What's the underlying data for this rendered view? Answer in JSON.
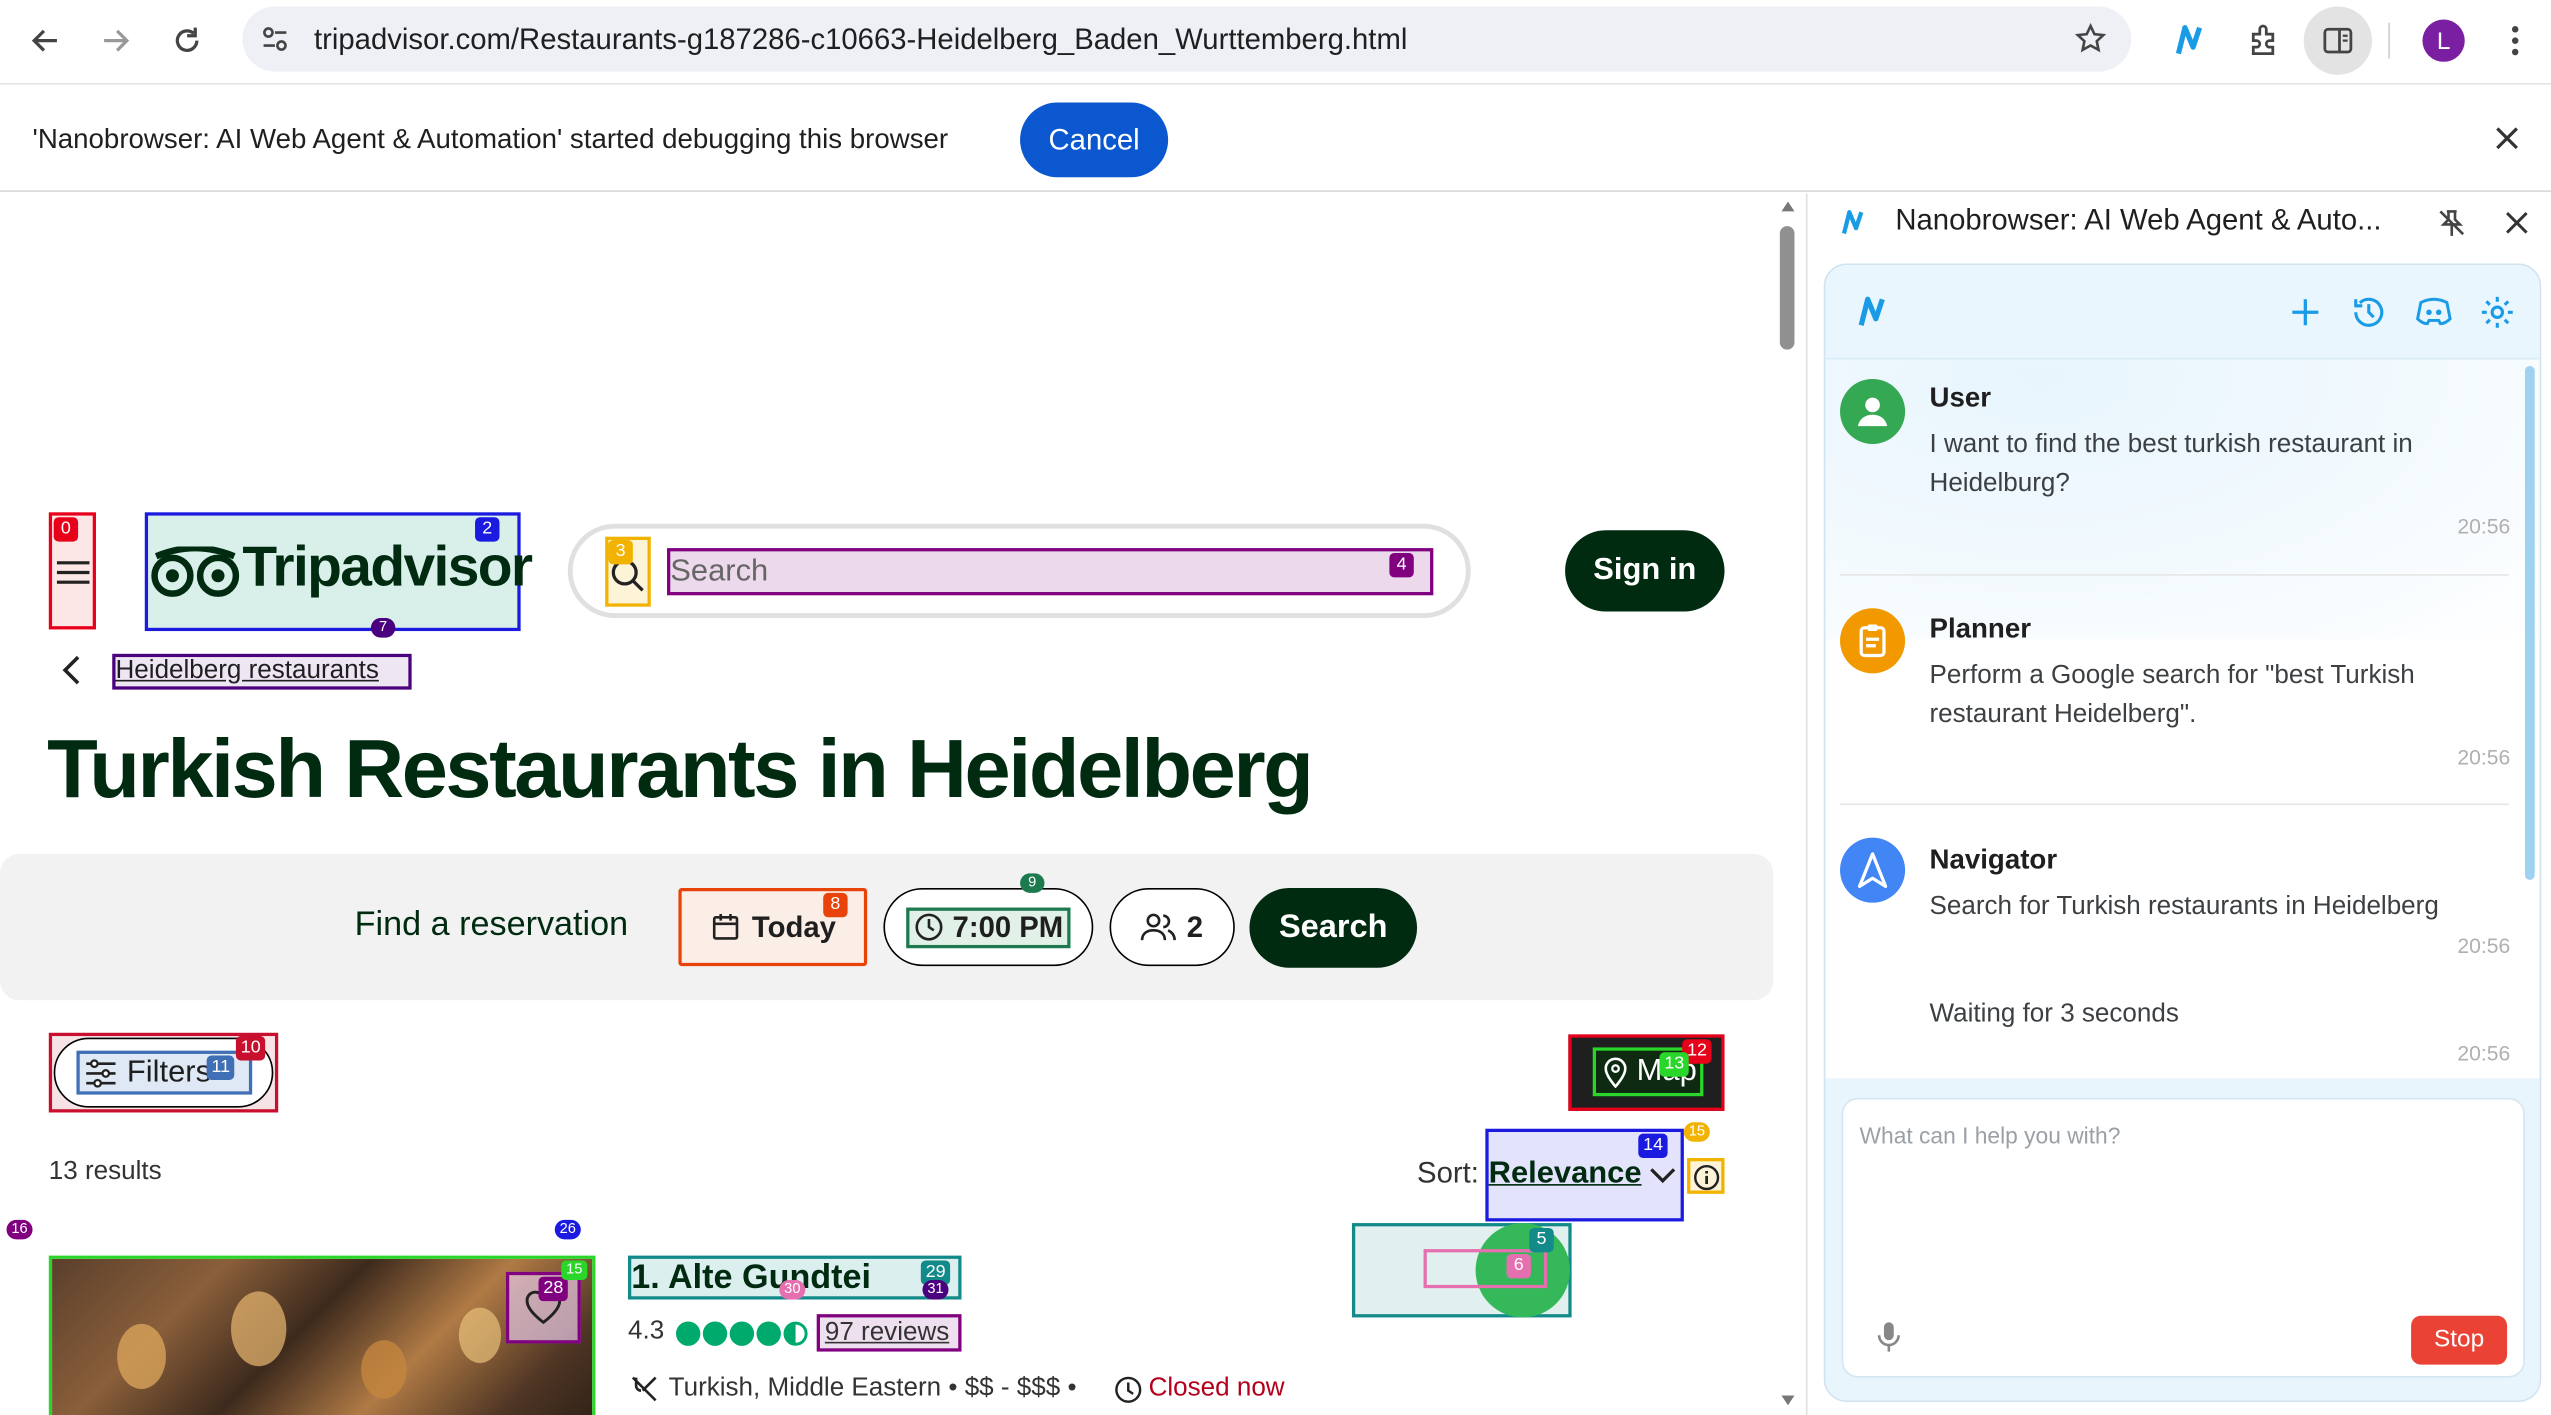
{
  "browser": {
    "url": "tripadvisor.com/Restaurants-g187286-c10663-Heidelberg_Baden_Wurttemberg.html",
    "profile_initial": "L",
    "infobar_text": "'Nanobrowser: AI Web Agent & Automation' started debugging this browser",
    "cancel_label": "Cancel",
    "colors": {
      "accent": "#0b57d0",
      "profile": "#7b1fa2"
    }
  },
  "page": {
    "search_placeholder": "Search",
    "sign_in_label": "Sign in",
    "logo_text": "Tripadvisor",
    "breadcrumb": "Heidelberg restaurants",
    "title": "Turkish Restaurants in Heidelberg",
    "reservation": {
      "label": "Find a reservation",
      "date": "Today",
      "time": "7:00 PM",
      "guests": "2",
      "search_label": "Search"
    },
    "filters_label": "Filters",
    "map_label": "Map",
    "results_count": "13 results",
    "sort_label": "Sort:",
    "sort_value": "Relevance",
    "restaurant": {
      "name": "1. Alte Gundtei",
      "rating": "4.3",
      "rating_bubbles": 4.5,
      "reviews": "97 reviews",
      "cuisine": "Turkish, Middle Eastern",
      "price": "$$ - $$$",
      "status": "Closed now"
    },
    "overlay_labels": {
      "l0": "0",
      "l2": "2",
      "l3": "3",
      "l4": "4",
      "l5": "5",
      "l6": "6",
      "l7": "7",
      "l8": "8",
      "l9": "9",
      "l10": "10",
      "l11": "11",
      "l12": "12",
      "l13": "13",
      "l14": "14",
      "l15a": "15",
      "l15b": "15",
      "l16": "16",
      "l26": "26",
      "l28": "28",
      "l29": "29",
      "l30": "30",
      "l31": "31"
    },
    "colors": {
      "brand_dark": "#002b11",
      "closed": "#b3001b",
      "rating": "#00aa6c"
    }
  },
  "side_panel": {
    "title": "Nanobrowser: AI Web Agent & Auto...",
    "messages": [
      {
        "sender": "User",
        "text": "I want to find the best turkish restaurant in Heidelburg?",
        "time": "20:56"
      },
      {
        "sender": "Planner",
        "text": "Perform a Google search for \"best Turkish restaurant Heidelberg\".",
        "time": "20:56"
      },
      {
        "sender": "Navigator",
        "text": "Search for Turkish restaurants in Heidelberg",
        "time": "20:56"
      },
      {
        "sender": "",
        "text": "Waiting for 3 seconds",
        "time": "20:56"
      }
    ],
    "input_placeholder": "What can I help you with?",
    "stop_label": "Stop",
    "colors": {
      "user": "#34a853",
      "planner": "#f29900",
      "navigator": "#4285f4",
      "accent": "#1a9be6",
      "stop": "#ea4335"
    }
  }
}
